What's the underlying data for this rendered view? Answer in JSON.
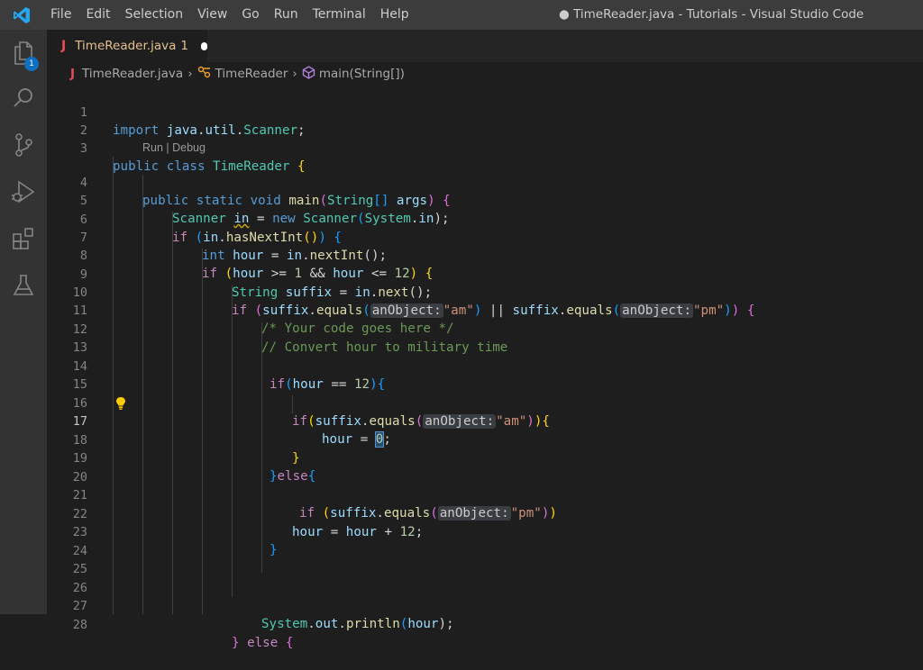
{
  "menu": [
    "File",
    "Edit",
    "Selection",
    "View",
    "Go",
    "Run",
    "Terminal",
    "Help"
  ],
  "window_title": "● TimeReader.java - Tutorials - Visual Studio Code",
  "activity": {
    "explorer_badge": "1",
    "icons": [
      "explorer-icon",
      "search-icon",
      "source-control-icon",
      "run-debug-icon",
      "extensions-icon",
      "testing-icon"
    ]
  },
  "tab": {
    "file_icon": "J",
    "label": "TimeReader.java",
    "problem_count": "1"
  },
  "breadcrumb": {
    "file_icon": "J",
    "file": "TimeReader.java",
    "class": "TimeReader",
    "method": "main(String[])"
  },
  "codelens": "Run | Debug",
  "line_numbers": [
    "1",
    "2",
    "3",
    "4",
    "5",
    "6",
    "7",
    "8",
    "9",
    "10",
    "11",
    "12",
    "13",
    "14",
    "15",
    "16",
    "17",
    "18",
    "19",
    "20",
    "21",
    "22",
    "23",
    "24",
    "25",
    "26",
    "27",
    "28"
  ],
  "active_line": "17",
  "code": {
    "l1": {
      "a": "import ",
      "b": "java",
      "c": ".",
      "d": "util",
      "e": ".",
      "f": "Scanner",
      "g": ";"
    },
    "l3": {
      "a": "public ",
      "b": "class ",
      "c": "TimeReader ",
      "d": "{"
    },
    "l4": {
      "a": "public ",
      "b": "static ",
      "c": "void ",
      "d": "main",
      "e": "(",
      "f": "String",
      "g": "[] ",
      "h": "args",
      "i": ") ",
      "j": "{"
    },
    "l5": {
      "a": "Scanner ",
      "b": "in",
      "c": " = ",
      "d": "new ",
      "e": "Scanner",
      "f": "(",
      "g": "System",
      "h": ".",
      "i": "in",
      "j": ");"
    },
    "l6": {
      "a": "if ",
      "b": "(",
      "c": "in",
      "d": ".",
      "e": "hasNextInt",
      "f": "()",
      "g": ") ",
      "h": "{"
    },
    "l7": {
      "a": "int ",
      "b": "hour",
      "c": " = ",
      "d": "in",
      "e": ".",
      "f": "nextInt",
      "g": "();"
    },
    "l8": {
      "a": "if ",
      "b": "(",
      "c": "hour",
      "d": " >= ",
      "e": "1",
      "f": " && ",
      "g": "hour",
      "h": " <= ",
      "i": "12",
      "j": ") ",
      "k": "{"
    },
    "l9": {
      "a": "String ",
      "b": "suffix",
      "c": " = ",
      "d": "in",
      "e": ".",
      "f": "next",
      "g": "();"
    },
    "l10": {
      "a": "if ",
      "b": "(",
      "c": "suffix",
      "d": ".",
      "e": "equals",
      "f": "(",
      "g": "anObject:",
      "h": "\"am\"",
      "i": ")",
      "j": " || ",
      "k": "suffix",
      "l": ".",
      "m": "equals",
      "n": "(",
      "o": "anObject:",
      "p": "\"pm\"",
      "q": ")",
      "r": ") ",
      "s": "{"
    },
    "l11": "/* Your code goes here */",
    "l12": "// Convert hour to military time",
    "l14": {
      "a": "if",
      "b": "(",
      "c": "hour",
      "d": " == ",
      "e": "12",
      "f": ")",
      "g": "{"
    },
    "l16": {
      "a": "if",
      "b": "(",
      "c": "suffix",
      "d": ".",
      "e": "equals",
      "f": "(",
      "g": "anObject:",
      "h": "\"am\"",
      "i": ")",
      "j": ")",
      "k": "{"
    },
    "l17": {
      "a": "hour",
      "b": " = ",
      "c": "0",
      "d": ";"
    },
    "l18": "}",
    "l19": {
      "a": "}",
      "b": "else",
      "c": "{"
    },
    "l21": {
      "a": "if ",
      "b": "(",
      "c": "suffix",
      "d": ".",
      "e": "equals",
      "f": "(",
      "g": "anObject:",
      "h": "\"pm\"",
      "i": ")",
      "j": ")"
    },
    "l22": {
      "a": "hour",
      "b": " = ",
      "c": "hour",
      "d": " + ",
      "e": "12",
      "f": ";"
    },
    "l23": "}",
    "l27": {
      "a": "System",
      "b": ".",
      "c": "out",
      "d": ".",
      "e": "println",
      "f": "(",
      "g": "hour",
      "h": ");"
    },
    "l28": {
      "a": "} ",
      "b": "else ",
      "c": "{"
    }
  },
  "colors": {
    "keyword": "#569cd6",
    "control": "#c586c0",
    "type": "#4ec9b0",
    "variable": "#9cdcfe",
    "function": "#dcdcaa",
    "string": "#ce9178",
    "number": "#b5cea8",
    "comment": "#6a9955",
    "accent": "#0e70c0"
  }
}
